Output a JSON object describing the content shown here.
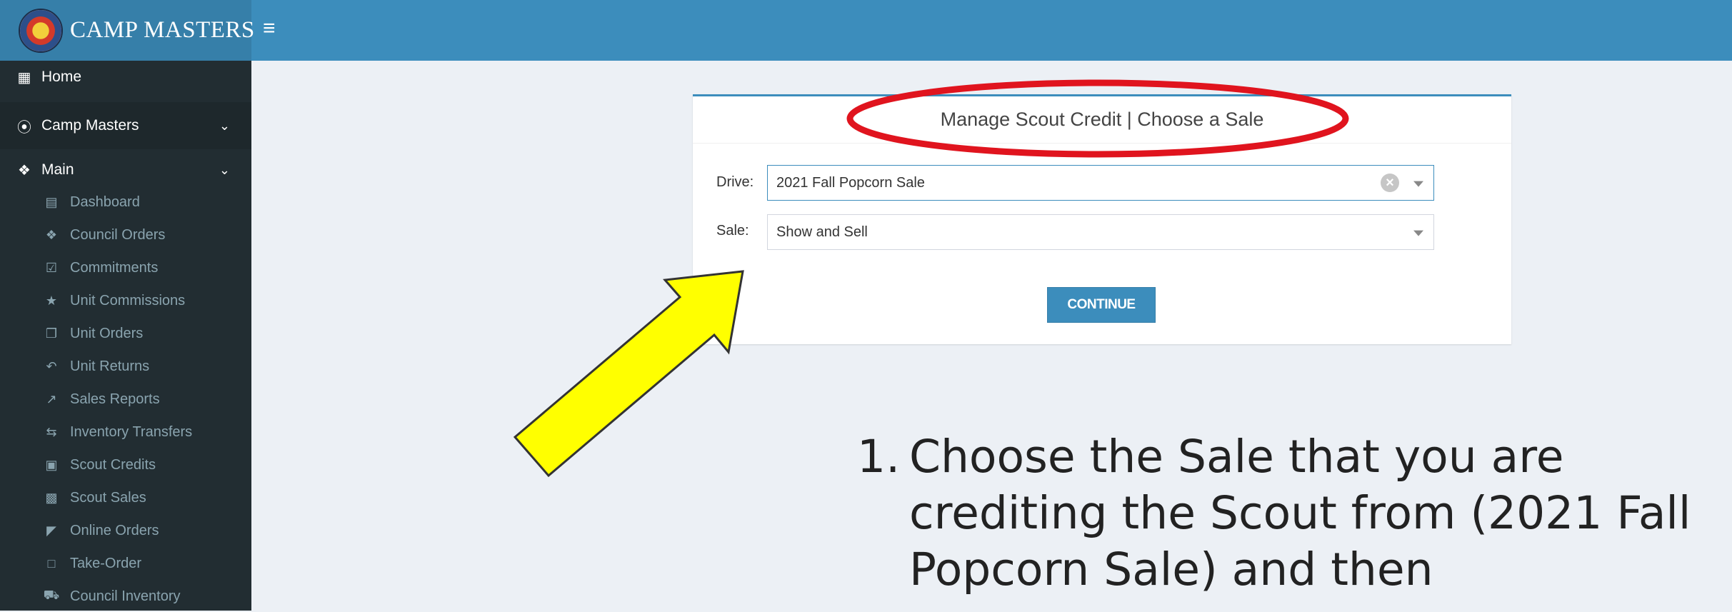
{
  "app": {
    "brand": "CAMP MASTERS",
    "menu_icon": "hamburger-icon"
  },
  "sidebar": {
    "home": {
      "label": "Home",
      "icon": "grid-icon"
    },
    "camp_masters": {
      "label": "Camp Masters",
      "icon": "compass-icon"
    },
    "main": {
      "label": "Main",
      "icon": "cubes-icon"
    },
    "items": [
      {
        "label": "Dashboard",
        "icon": "dashboard-icon"
      },
      {
        "label": "Council Orders",
        "icon": "cubes-icon"
      },
      {
        "label": "Commitments",
        "icon": "check-square-icon"
      },
      {
        "label": "Unit Commissions",
        "icon": "star-icon"
      },
      {
        "label": "Unit Orders",
        "icon": "cube-icon"
      },
      {
        "label": "Unit Returns",
        "icon": "reply-icon"
      },
      {
        "label": "Sales Reports",
        "icon": "line-chart-icon"
      },
      {
        "label": "Inventory Transfers",
        "icon": "exchange-icon"
      },
      {
        "label": "Scout Credits",
        "icon": "money-icon"
      },
      {
        "label": "Scout Sales",
        "icon": "calculator-icon"
      },
      {
        "label": "Online Orders",
        "icon": "shopping-basket-icon"
      },
      {
        "label": "Take-Order",
        "icon": "square-icon"
      },
      {
        "label": "Council Inventory",
        "icon": "truck-icon"
      }
    ]
  },
  "panel": {
    "title": "Manage Scout Credit | Choose a Sale",
    "drive_label": "Drive:",
    "drive_value": "2021 Fall Popcorn Sale",
    "sale_label": "Sale:",
    "sale_value": "Show and Sell",
    "continue_label": "CONTINUE"
  },
  "annotation": {
    "number": "1.",
    "text": "Choose the Sale that you are crediting the Scout from (2021 Fall Popcorn Sale) and then",
    "highlight_color": "#e0141e",
    "arrow_color": "#ffff00"
  }
}
